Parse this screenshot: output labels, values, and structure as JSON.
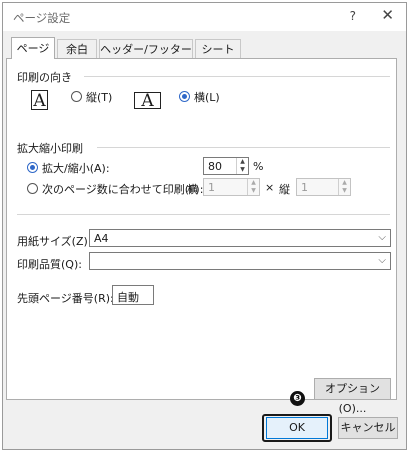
{
  "window": {
    "title": "ページ設定",
    "help_label": "?",
    "close_label": "✕"
  },
  "tabs": [
    {
      "label": "ページ",
      "active": true
    },
    {
      "label": "余白"
    },
    {
      "label": "ヘッダー/フッター"
    },
    {
      "label": "シート"
    }
  ],
  "orientation": {
    "section_label": "印刷の向き",
    "icon_letter": "A",
    "portrait_label": "縦(T)",
    "landscape_label": "横(L)",
    "selected": "landscape"
  },
  "scaling": {
    "section_label": "拡大縮小印刷",
    "zoom_label": "拡大/縮小(A):",
    "zoom_value": "80",
    "zoom_unit": "%",
    "fit_label": "次のページ数に合わせて印刷(F):",
    "fit_wide_label": "横",
    "fit_wide_value": "1",
    "times_label": "×",
    "fit_tall_label": "縦",
    "fit_tall_value": "1",
    "selected": "zoom"
  },
  "paper_size": {
    "label": "用紙サイズ(Z):",
    "value": "A4"
  },
  "print_quality": {
    "label": "印刷品質(Q):",
    "value": ""
  },
  "first_page": {
    "label": "先頭ページ番号(R):",
    "value": "自動"
  },
  "buttons": {
    "options_label": "オプション(O)...",
    "ok_label": "OK",
    "cancel_label": "キャンセル"
  },
  "annotation": {
    "badge": "❸"
  }
}
